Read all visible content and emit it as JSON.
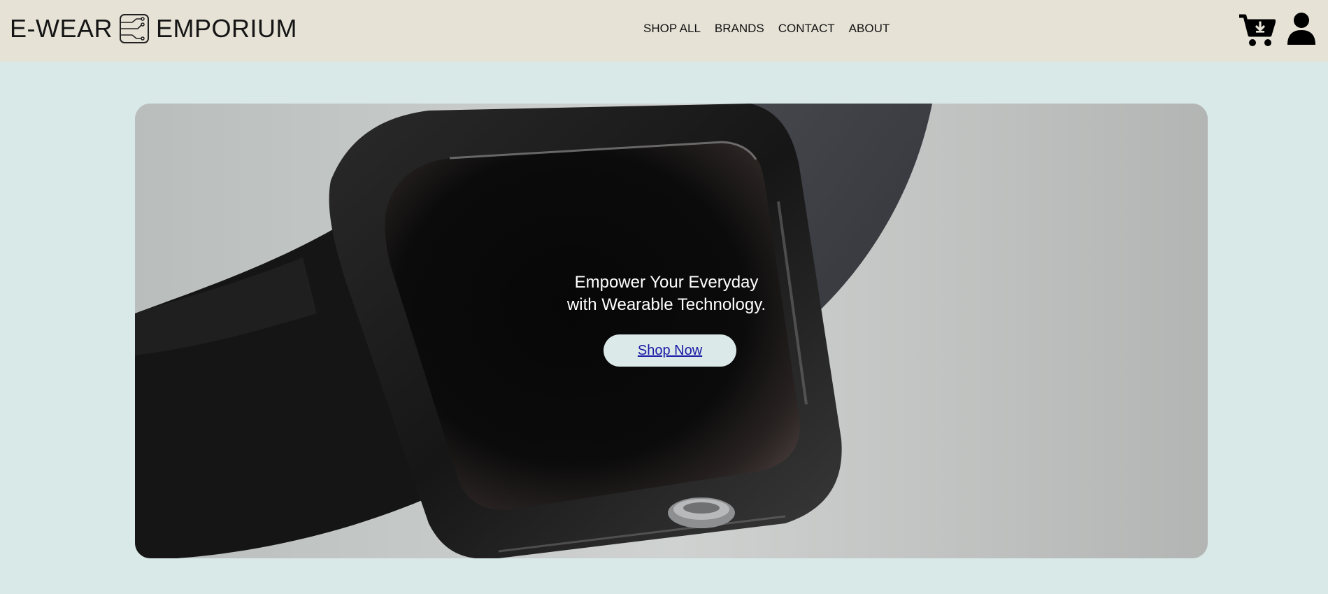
{
  "brand": {
    "name_left": "E-WEAR",
    "name_right": "EMPORIUM",
    "logo_icon": "circuit-chip-icon"
  },
  "nav": {
    "items": [
      {
        "label": "SHOP ALL"
      },
      {
        "label": "BRANDS"
      },
      {
        "label": "CONTACT"
      },
      {
        "label": "ABOUT"
      }
    ]
  },
  "header_icons": {
    "cart": "cart-download-icon",
    "account": "user-icon"
  },
  "hero": {
    "headline_line1": "Empower Your Everyday",
    "headline_line2": "with Wearable Technology.",
    "cta_label": "Shop Now",
    "image": "smartwatch-photo"
  },
  "colors": {
    "page_bg": "#d8e9e8",
    "header_bg": "#e6e2d6",
    "cta_bg": "#dbe9e8",
    "cta_text": "#1a1aa6"
  }
}
